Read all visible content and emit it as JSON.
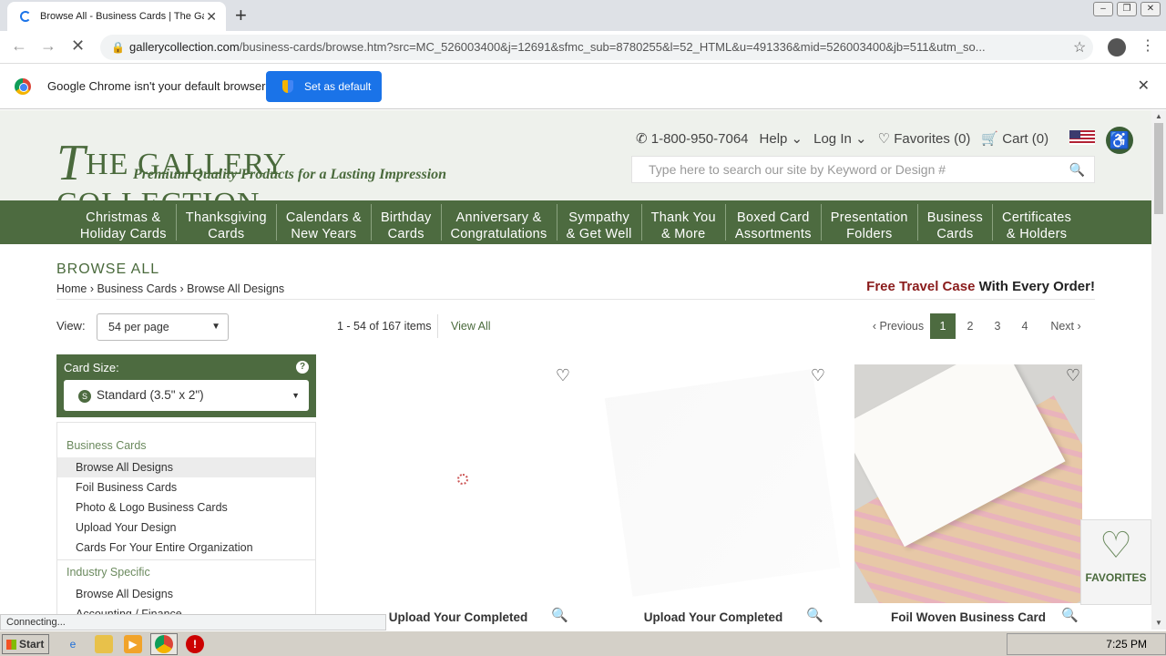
{
  "browser": {
    "tab_title": "Browse All - Business Cards | The Ga",
    "address_host": "gallerycollection.com",
    "address_path": "/business-cards/browse.htm?src=MC_526003400&j=12691&sfmc_sub=8780255&l=52_HTML&u=491336&mid=526003400&jb=511&utm_so...",
    "infobar_message": "Google Chrome isn't your default browser",
    "set_default_label": "Set as default",
    "status_text": "Connecting..."
  },
  "header": {
    "logo_main": "HE GALLERY COLLECTION",
    "logo_initial": "T",
    "logo_tagline": "Premium Quality Products for a Lasting Impression",
    "phone": "1-800-950-7064",
    "help": "Help",
    "login": "Log In",
    "favorites": "Favorites (0)",
    "cart": "Cart (0)",
    "search_placeholder": "Type here to search our site by Keyword or Design #"
  },
  "nav": [
    {
      "line1": "Christmas &",
      "line2": "Holiday Cards"
    },
    {
      "line1": "Thanksgiving",
      "line2": "Cards"
    },
    {
      "line1": "Calendars &",
      "line2": "New Years"
    },
    {
      "line1": "Birthday",
      "line2": "Cards"
    },
    {
      "line1": "Anniversary &",
      "line2": "Congratulations"
    },
    {
      "line1": "Sympathy",
      "line2": "& Get Well"
    },
    {
      "line1": "Thank You",
      "line2": "& More"
    },
    {
      "line1": "Boxed Card",
      "line2": "Assortments"
    },
    {
      "line1": "Presentation",
      "line2": "Folders"
    },
    {
      "line1": "Business",
      "line2": "Cards"
    },
    {
      "line1": "Certificates",
      "line2": "& Holders"
    }
  ],
  "page": {
    "title": "BROWSE ALL",
    "breadcrumb": [
      "Home",
      "Business Cards",
      "Browse All Designs"
    ],
    "promo_red": "Free Travel Case",
    "promo_rest": " With Every Order!",
    "view_label": "View:",
    "view_value": "54 per page",
    "item_count": "1 - 54 of 167 items",
    "view_all": "View All",
    "pager": {
      "prev": "‹ Previous",
      "pages": [
        "1",
        "2",
        "3",
        "4"
      ],
      "next": "Next ›",
      "current": "1"
    }
  },
  "filters": {
    "card_size_label": "Card Size:",
    "card_size_value": "Standard (3.5\" x 2\")",
    "group1_title": "Business Cards",
    "group1_items": [
      "Browse All Designs",
      "Foil Business Cards",
      "Photo & Logo Business Cards",
      "Upload Your Design",
      "Cards For Your Entire Organization"
    ],
    "group2_title": "Industry Specific",
    "group2_items": [
      "Browse All Designs",
      "Accounting / Finance"
    ]
  },
  "products": [
    {
      "name": "Upload Your Completed"
    },
    {
      "name": "Upload Your Completed"
    },
    {
      "name": "Foil Woven Business Card"
    }
  ],
  "widget": {
    "favorites": "FAVORITES"
  },
  "taskbar": {
    "start": "Start",
    "clock": "7:25 PM"
  },
  "colors": {
    "brand_green": "#4d6b40",
    "promo_red": "#8a1c1c",
    "chrome_blue": "#1a73e8"
  }
}
